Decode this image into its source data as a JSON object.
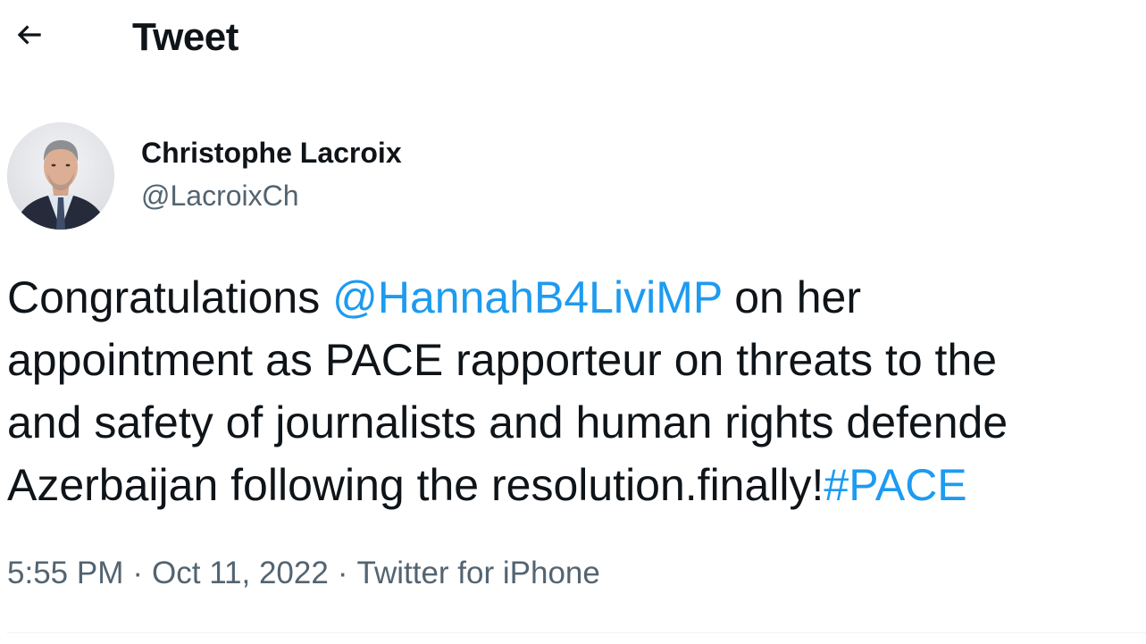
{
  "header": {
    "title": "Tweet",
    "back_icon": "arrow-left-icon"
  },
  "author": {
    "name": "Christophe Lacroix",
    "handle": "@LacroixCh",
    "avatar": "profile-photo"
  },
  "tweet": {
    "lines": [
      [
        {
          "text": "Congratulations ",
          "type": "text"
        },
        {
          "text": "@HannahB4LiviMP",
          "type": "mention"
        },
        {
          "text": " on her",
          "type": "text"
        }
      ],
      [
        {
          "text": "appointment as PACE rapporteur on threats to the",
          "type": "text"
        }
      ],
      [
        {
          "text": "and safety of journalists and human rights defende",
          "type": "text"
        }
      ],
      [
        {
          "text": "Azerbaijan following the resolution.finally!",
          "type": "text"
        },
        {
          "text": "#PACE",
          "type": "hashtag"
        }
      ]
    ]
  },
  "meta": {
    "time": "5:55 PM",
    "separator": "·",
    "date": "Oct 11, 2022",
    "source": "Twitter for iPhone"
  },
  "colors": {
    "text": "#0f1419",
    "secondary": "#536471",
    "link": "#1d9bf0",
    "divider": "#eff3f4"
  }
}
